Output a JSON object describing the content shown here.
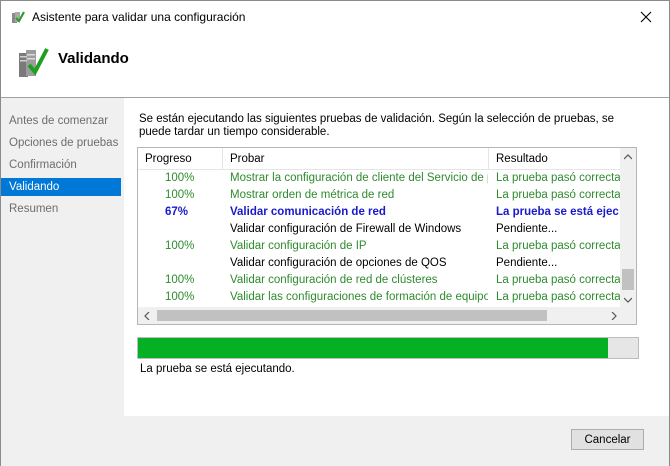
{
  "window": {
    "title": "Asistente para validar una configuración"
  },
  "header": {
    "title": "Validando"
  },
  "nav": {
    "items": [
      {
        "label": "Antes de comenzar",
        "active": false
      },
      {
        "label": "Opciones de pruebas",
        "active": false
      },
      {
        "label": "Confirmación",
        "active": false
      },
      {
        "label": "Validando",
        "active": true
      },
      {
        "label": "Resumen",
        "active": false
      }
    ]
  },
  "main": {
    "description": "Se están ejecutando las siguientes pruebas de validación. Según la selección de pruebas, se puede tardar un tiempo considerable.",
    "columns": [
      "Progreso",
      "Probar",
      "Resultado"
    ],
    "rows": [
      {
        "progress": "100%",
        "test": "Mostrar la configuración de cliente del Servicio de p...",
        "result": "La prueba pasó correctame",
        "state": "pass"
      },
      {
        "progress": "100%",
        "test": "Mostrar orden de métrica de red",
        "result": "La prueba pasó correctame",
        "state": "pass"
      },
      {
        "progress": "67%",
        "test": "Validar comunicación de red",
        "result": "La prueba se está ejec",
        "state": "running"
      },
      {
        "progress": "",
        "test": "Validar configuración de Firewall de Windows",
        "result": "Pendiente...",
        "state": "pending"
      },
      {
        "progress": "100%",
        "test": "Validar configuración de IP",
        "result": "La prueba pasó correctame",
        "state": "pass"
      },
      {
        "progress": "",
        "test": "Validar configuración de opciones de QOS",
        "result": "Pendiente...",
        "state": "pending"
      },
      {
        "progress": "100%",
        "test": "Validar configuración de red de clústeres",
        "result": "La prueba pasó correctame",
        "state": "pass"
      },
      {
        "progress": "100%",
        "test": "Validar las configuraciones de formación de equipo...",
        "result": "La prueba pasó correctame",
        "state": "pass"
      }
    ],
    "progress_fraction": 0.94,
    "status": "La prueba se está ejecutando."
  },
  "footer": {
    "cancel_label": "Cancelar"
  },
  "colors": {
    "accent": "#0078d7",
    "pass": "#2e8b2e",
    "running": "#1a1acd",
    "progress": "#06b025"
  },
  "icons": {
    "title": "cluster-check-icon",
    "header": "cluster-validate-icon",
    "close": "close-icon"
  }
}
